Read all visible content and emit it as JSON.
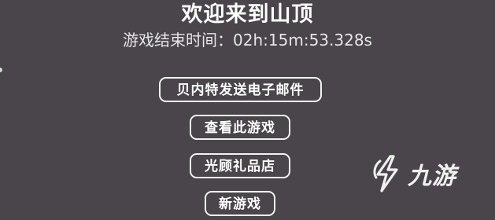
{
  "header": {
    "title": "欢迎来到山顶",
    "timer_label": "游戏结束时间：",
    "timer_value": "02h:15m:53.328s"
  },
  "menu": {
    "email_button": "贝内特发送电子邮件",
    "view_game_button": "查看此游戏",
    "gift_shop_button": "光顾礼品店",
    "new_game_button": "新游戏"
  },
  "watermark": {
    "text": "九游",
    "icon": "jiuyou-logo-icon"
  },
  "colors": {
    "background": "#49454a",
    "text": "#ffffff",
    "button_border": "#f2f2f2"
  }
}
